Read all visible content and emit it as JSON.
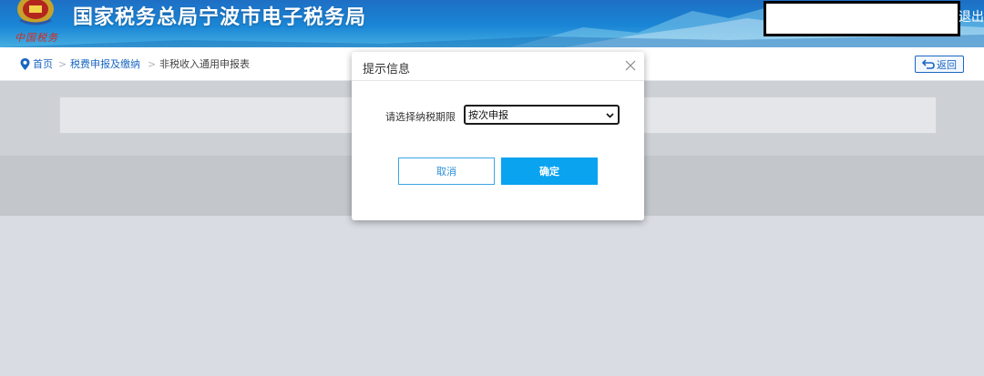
{
  "header": {
    "site_title": "国家税务总局宁波市电子税务局",
    "logout_label": "退出",
    "logo_text": "中国税务"
  },
  "breadcrumb": {
    "home": "首页",
    "separator": ">",
    "level1": "税费申报及缴纳",
    "current": "非税收入通用申报表"
  },
  "back_button": {
    "label": "返回"
  },
  "dialog": {
    "title": "提示信息",
    "field_label": "请选择纳税期限",
    "selected_option": "按次申报",
    "cancel_label": "取消",
    "confirm_label": "确定"
  },
  "colors": {
    "brand_blue": "#1a66c2",
    "confirm_button": "#0aa3f0",
    "header_gradient_top": "#1e6fc4"
  },
  "icons": {
    "home": "map-pin-icon",
    "back": "return-arrow-icon",
    "close": "close-icon",
    "dropdown": "chevron-down-icon",
    "emblem": "tax-emblem-icon"
  }
}
